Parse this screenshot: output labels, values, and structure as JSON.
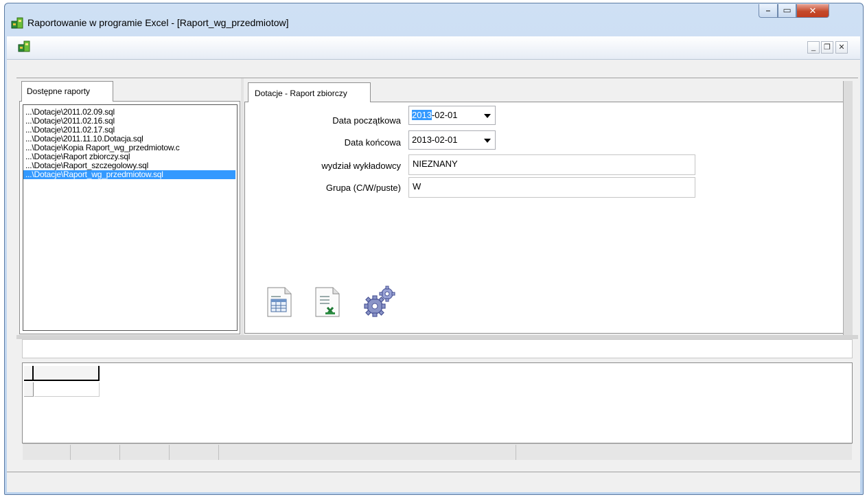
{
  "window": {
    "title": "Raportowanie w programie Excel - [Raport_wg_przedmiotow]",
    "min_glyph": "–",
    "max_glyph": "▭",
    "close_glyph": "✕"
  },
  "mdi": {
    "min_glyph": "_",
    "restore_glyph": "❐",
    "close_glyph": "✕"
  },
  "left_panel": {
    "tab_label": "Dostępne raporty",
    "items": [
      "...\\Dotacje\\2011.02.09.sql",
      "...\\Dotacje\\2011.02.16.sql",
      "...\\Dotacje\\2011.02.17.sql",
      "...\\Dotacje\\2011.11.10.Dotacja.sql",
      "...\\Dotacje\\Kopia Raport_wg_przedmiotow.c",
      "...\\Dotacje\\Raport zbiorczy.sql",
      "...\\Dotacje\\Raport_szczegolowy.sql",
      "...\\Dotacje\\Raport_wg_przedmiotow.sql"
    ],
    "selected_index": 7
  },
  "right_panel": {
    "tab_label": "Dotacje - Raport zbiorczy",
    "fields": {
      "start_label": "Data początkowa",
      "start_value_sel": "2013",
      "start_value_rest": "-02-01",
      "end_label": "Data końcowa",
      "end_value": "2013-02-01",
      "dept_label": "wydział wykładowcy",
      "dept_value": "NIEZNANY",
      "group_label": "Grupa (C/W/puste)",
      "group_value": "W"
    }
  },
  "icons": {
    "grid": "table-report-icon",
    "excel": "excel-export-icon",
    "run": "gears-icon"
  },
  "colors": {
    "selection": "#3399ff",
    "titlebar": "#c7daf1",
    "close": "#c44a2b"
  }
}
